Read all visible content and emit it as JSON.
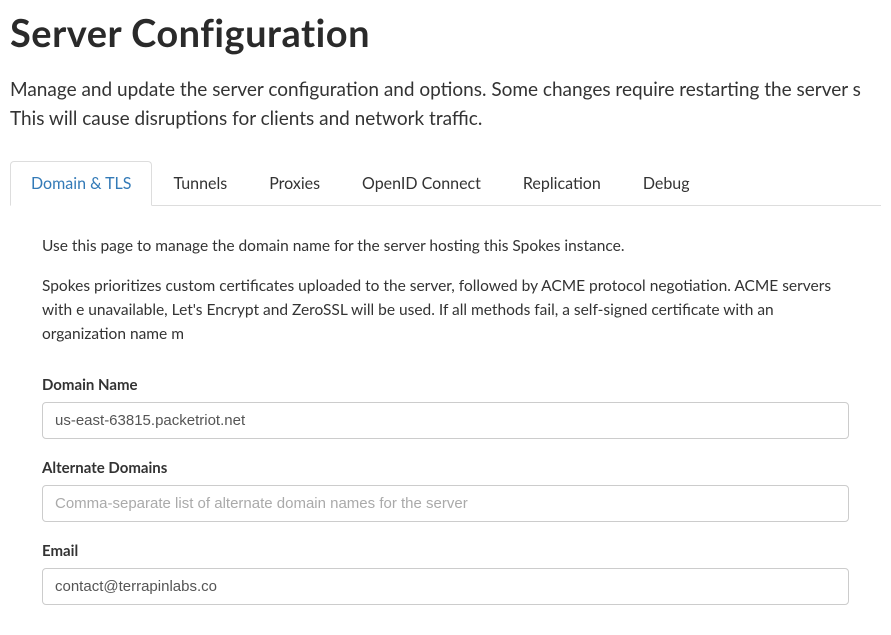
{
  "page": {
    "title": "Server Configuration",
    "description": "Manage and update the server configuration and options. Some changes require restarting the server s This will cause disruptions for clients and network traffic."
  },
  "tabs": [
    {
      "label": "Domain & TLS",
      "active": true
    },
    {
      "label": "Tunnels",
      "active": false
    },
    {
      "label": "Proxies",
      "active": false
    },
    {
      "label": "OpenID Connect",
      "active": false
    },
    {
      "label": "Replication",
      "active": false
    },
    {
      "label": "Debug",
      "active": false
    }
  ],
  "content": {
    "intro1": "Use this page to manage the domain name for the server hosting this Spokes instance.",
    "intro2": "Spokes prioritizes custom certificates uploaded to the server, followed by ACME protocol negotiation. ACME servers with e unavailable, Let's Encrypt and ZeroSSL will be used. If all methods fail, a self-signed certificate with an organization name m"
  },
  "form": {
    "domain_name": {
      "label": "Domain Name",
      "value": "us-east-63815.packetriot.net"
    },
    "alternate_domains": {
      "label": "Alternate Domains",
      "value": "",
      "placeholder": "Comma-separate list of alternate domain names for the server"
    },
    "email": {
      "label": "Email",
      "value": "contact@terrapinlabs.co"
    }
  }
}
